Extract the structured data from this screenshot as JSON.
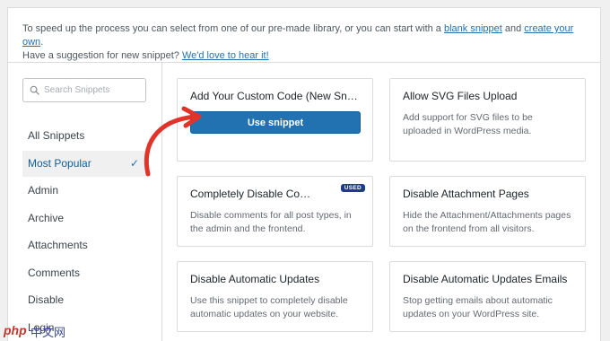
{
  "intro": {
    "text_before": "To speed up the process you can select from one of our pre-made library, or you can start with a ",
    "link_blank": "blank snippet",
    "text_and": " and ",
    "link_create": "create your own",
    "text_period": ".",
    "text_suggestion": "Have a suggestion for new snippet? ",
    "link_suggest": "We'd love to hear it!"
  },
  "search": {
    "placeholder": "Search Snippets"
  },
  "sidebar": {
    "items": [
      {
        "label": "All Snippets"
      },
      {
        "label": "Most Popular",
        "active": true,
        "check": "✓"
      },
      {
        "label": "Admin"
      },
      {
        "label": "Archive"
      },
      {
        "label": "Attachments"
      },
      {
        "label": "Comments"
      },
      {
        "label": "Disable"
      },
      {
        "label": "Login"
      }
    ]
  },
  "cards": [
    {
      "title": "Add Your Custom Code (New Snippet)",
      "button": "Use snippet"
    },
    {
      "title": "Allow SVG Files Upload",
      "desc": "Add support for SVG files to be uploaded in WordPress media."
    },
    {
      "title": "Completely Disable Comments",
      "badge": "USED",
      "desc": "Disable comments for all post types, in the admin and the frontend."
    },
    {
      "title": "Disable Attachment Pages",
      "desc": "Hide the Attachment/Attachments pages on the frontend from all visitors."
    },
    {
      "title": "Disable Automatic Updates",
      "desc": "Use this snippet to completely disable automatic updates on your website."
    },
    {
      "title": "Disable Automatic Updates Emails",
      "desc": "Stop getting emails about automatic updates on your WordPress site."
    }
  ],
  "icons": {
    "search": "search-icon",
    "check": "check-icon",
    "arrow": "curved-arrow-icon"
  },
  "colors": {
    "accent": "#2271b1",
    "arrow": "#e0342b",
    "badge": "#1e3a8a"
  },
  "watermark": {
    "latin": "php",
    "cn": "中文网"
  }
}
